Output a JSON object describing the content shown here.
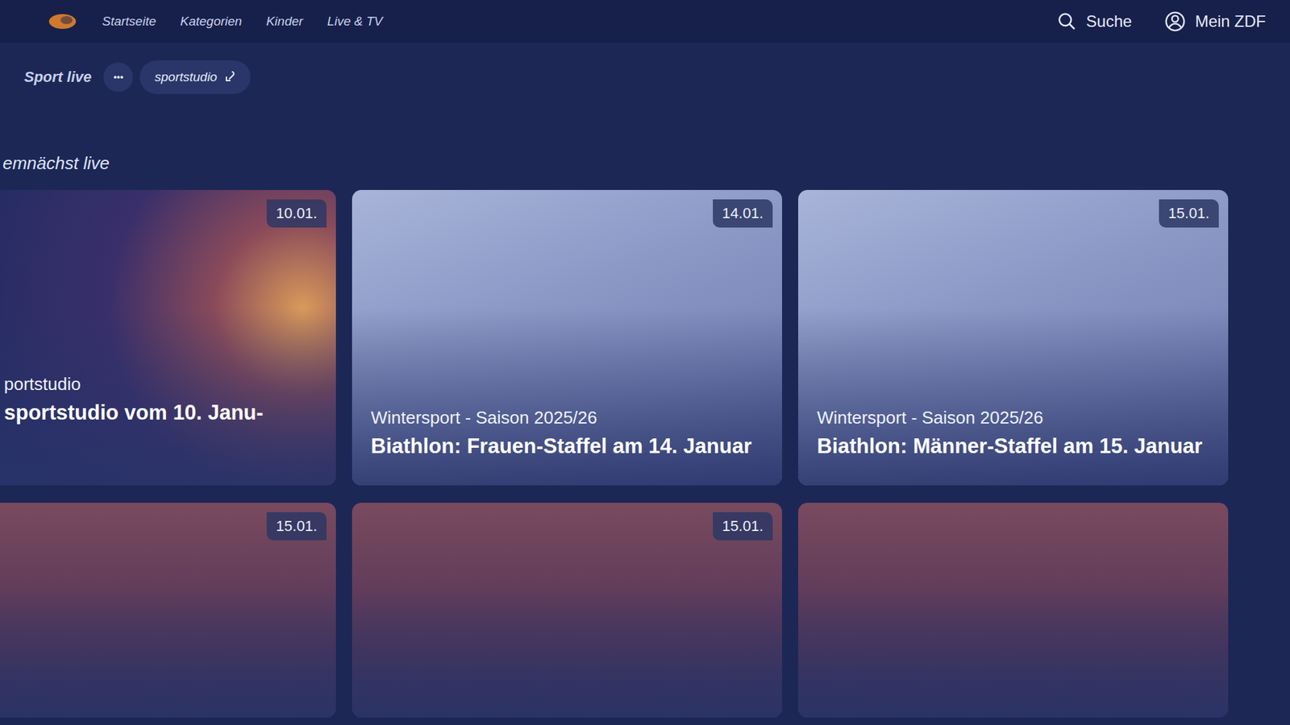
{
  "header": {
    "nav": [
      {
        "label": "Startseite",
        "selected": false
      },
      {
        "label": "Kategorien",
        "selected": false
      },
      {
        "label": "Kinder",
        "selected": false
      },
      {
        "label": "Live & TV",
        "selected": false
      }
    ],
    "search": "Suche",
    "account": "Mein ZDF"
  },
  "subnav": {
    "title": "Sport live",
    "more": "•••",
    "chip": "sportstudio"
  },
  "section": {
    "title": "emnächst live"
  },
  "rows": [
    [
      {
        "kind": "sportstudio",
        "date": "10.01.",
        "kicker": "portstudio",
        "title": "sportstudio vom 10. Janu-"
      },
      {
        "kind": "biathlon",
        "date": "14.01.",
        "kicker": "Wintersport - Saison 2025/26",
        "title": "Biathlon: Frauen-Staffel am 14. Januar"
      },
      {
        "kind": "biathlon",
        "date": "15.01.",
        "kicker": "Wintersport - Saison 2025/26",
        "title": "Biathlon: Männer-Staffel am 15. Januar"
      }
    ],
    [
      {
        "kind": "handball",
        "date": "15.01.",
        "kicker": "",
        "title": ""
      },
      {
        "kind": "handball",
        "date": "15.01.",
        "kicker": "",
        "title": ""
      },
      {
        "kind": "handball",
        "date": "",
        "kicker": "",
        "title": ""
      }
    ]
  ]
}
